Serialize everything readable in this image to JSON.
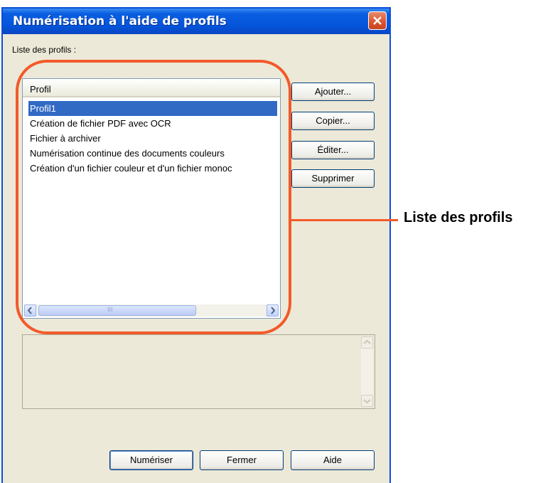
{
  "window": {
    "title": "Numérisation à l'aide de profils"
  },
  "profiles": {
    "label": "Liste des profils :",
    "column_header": "Profil",
    "items": [
      "Profil1",
      "Création de fichier PDF avec OCR",
      "Fichier à archiver",
      "Numérisation continue des documents couleurs",
      "Création d'un fichier couleur et d'un fichier monoc"
    ],
    "selected_index": 0,
    "scroll_thumb_grip": "III"
  },
  "side_buttons": {
    "add": "Ajouter...",
    "copy": "Copier...",
    "edit": "Éditer...",
    "delete": "Supprimer"
  },
  "bottom_buttons": {
    "scan": "Numériser",
    "close": "Fermer",
    "help": "Aide"
  },
  "annotation": {
    "label": "Liste des profils",
    "color": "#f25a2a"
  },
  "colors": {
    "title_bar": "#0454da",
    "selection": "#316ac5",
    "dialog_bg": "#ece9d8"
  }
}
